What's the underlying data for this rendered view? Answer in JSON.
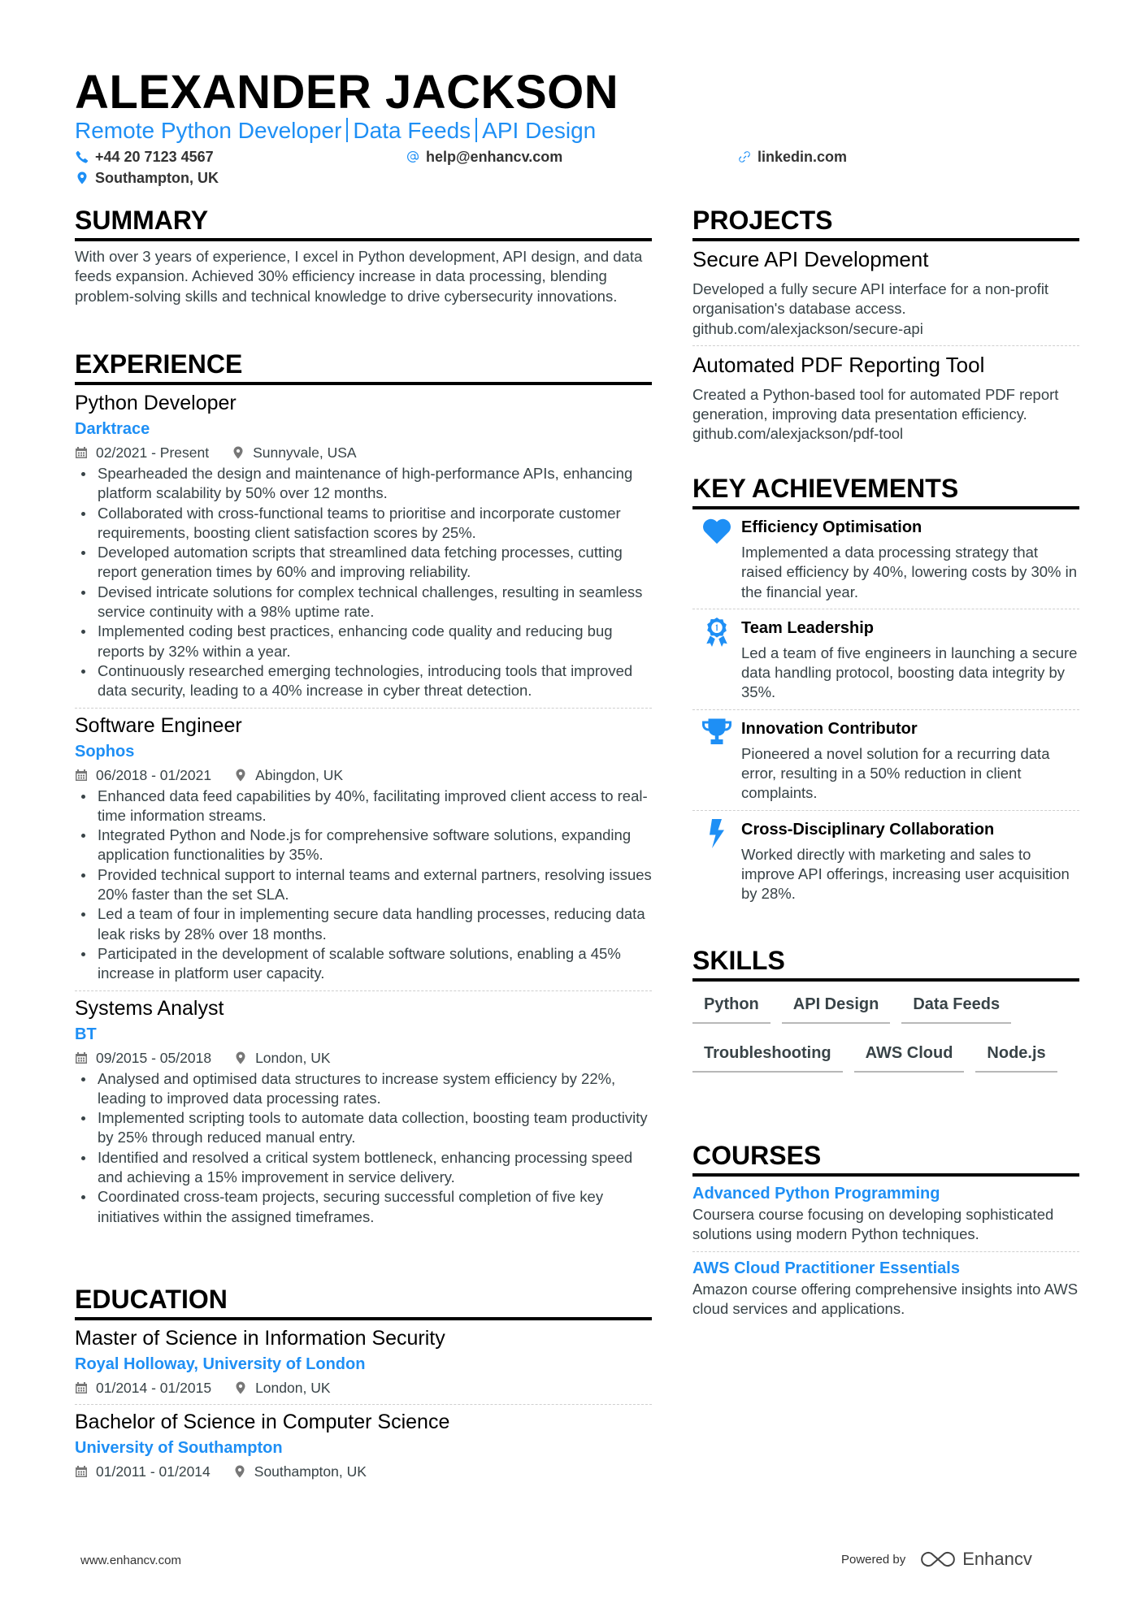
{
  "header": {
    "name": "ALEXANDER JACKSON",
    "title_parts": [
      "Remote Python Developer",
      "Data Feeds",
      "API Design"
    ],
    "phone": "+44 20 7123 4567",
    "email": "help@enhancv.com",
    "link": "linkedin.com",
    "location": "Southampton, UK"
  },
  "summary": {
    "heading": "SUMMARY",
    "text": "With over 3 years of experience, I excel in Python development, API design, and data feeds expansion. Achieved 30% efficiency increase in data processing, blending problem-solving skills and technical knowledge to drive cybersecurity innovations."
  },
  "experience": {
    "heading": "EXPERIENCE",
    "jobs": [
      {
        "title": "Python Developer",
        "company": "Darktrace",
        "dates": "02/2021 - Present",
        "location": "Sunnyvale, USA",
        "bullets": [
          "Spearheaded the design and maintenance of high-performance APIs, enhancing platform scalability by 50% over 12 months.",
          "Collaborated with cross-functional teams to prioritise and incorporate customer requirements, boosting client satisfaction scores by 25%.",
          "Developed automation scripts that streamlined data fetching processes, cutting report generation times by 60% and improving reliability.",
          "Devised intricate solutions for complex technical challenges, resulting in seamless service continuity with a 98% uptime rate.",
          "Implemented coding best practices, enhancing code quality and reducing bug reports by 32% within a year.",
          "Continuously researched emerging technologies, introducing tools that improved data security, leading to a 40% increase in cyber threat detection."
        ]
      },
      {
        "title": "Software Engineer",
        "company": "Sophos",
        "dates": "06/2018 - 01/2021",
        "location": "Abingdon, UK",
        "bullets": [
          "Enhanced data feed capabilities by 40%, facilitating improved client access to real-time information streams.",
          "Integrated Python and Node.js for comprehensive software solutions, expanding application functionalities by 35%.",
          "Provided technical support to internal teams and external partners, resolving issues 20% faster than the set SLA.",
          "Led a team of four in implementing secure data handling processes, reducing data leak risks by 28% over 18 months.",
          "Participated in the development of scalable software solutions, enabling a 45% increase in platform user capacity."
        ]
      },
      {
        "title": "Systems Analyst",
        "company": "BT",
        "dates": "09/2015 - 05/2018",
        "location": "London, UK",
        "bullets": [
          "Analysed and optimised data structures to increase system efficiency by 22%, leading to improved data processing rates.",
          "Implemented scripting tools to automate data collection, boosting team productivity by 25% through reduced manual entry.",
          "Identified and resolved a critical system bottleneck, enhancing processing speed and achieving a 15% improvement in service delivery.",
          "Coordinated cross-team projects, securing successful completion of five key initiatives within the assigned timeframes."
        ]
      }
    ]
  },
  "education": {
    "heading": "EDUCATION",
    "items": [
      {
        "degree": "Master of Science in Information Security",
        "school": "Royal Holloway, University of London",
        "dates": "01/2014 - 01/2015",
        "location": "London, UK"
      },
      {
        "degree": "Bachelor of Science in Computer Science",
        "school": "University of Southampton",
        "dates": "01/2011 - 01/2014",
        "location": "Southampton, UK"
      }
    ]
  },
  "projects": {
    "heading": "PROJECTS",
    "items": [
      {
        "title": "Secure API Development",
        "description": "Developed a fully secure API interface for a non-profit organisation's database access. github.com/alexjackson/secure-api"
      },
      {
        "title": "Automated PDF Reporting Tool",
        "description": "Created a Python-based tool for automated PDF report generation, improving data presentation efficiency. github.com/alexjackson/pdf-tool"
      }
    ]
  },
  "achievements": {
    "heading": "KEY ACHIEVEMENTS",
    "items": [
      {
        "icon": "heart-icon",
        "title": "Efficiency Optimisation",
        "description": "Implemented a data processing strategy that raised efficiency by 40%, lowering costs by 30% in the financial year."
      },
      {
        "icon": "award-ribbon-icon",
        "title": "Team Leadership",
        "description": "Led a team of five engineers in launching a secure data handling protocol, boosting data integrity by 35%."
      },
      {
        "icon": "trophy-icon",
        "title": "Innovation Contributor",
        "description": "Pioneered a novel solution for a recurring data error, resulting in a 50% reduction in client complaints."
      },
      {
        "icon": "lightning-bolt-icon",
        "title": "Cross-Disciplinary Collaboration",
        "description": "Worked directly with marketing and sales to improve API offerings, increasing user acquisition by 28%."
      }
    ]
  },
  "skills": {
    "heading": "SKILLS",
    "items": [
      "Python",
      "API Design",
      "Data Feeds",
      "Troubleshooting",
      "AWS Cloud",
      "Node.js"
    ]
  },
  "courses": {
    "heading": "COURSES",
    "items": [
      {
        "title": "Advanced Python Programming",
        "description": "Coursera course focusing on developing sophisticated solutions using modern Python techniques."
      },
      {
        "title": "AWS Cloud Practitioner Essentials",
        "description": "Amazon course offering comprehensive insights into AWS cloud services and applications."
      }
    ]
  },
  "footer": {
    "website": "www.enhancv.com",
    "powered_by": "Powered by",
    "brand": "Enhancv"
  },
  "colors": {
    "accent": "#1e8ff5",
    "text": "#384347",
    "heading": "#000000"
  }
}
